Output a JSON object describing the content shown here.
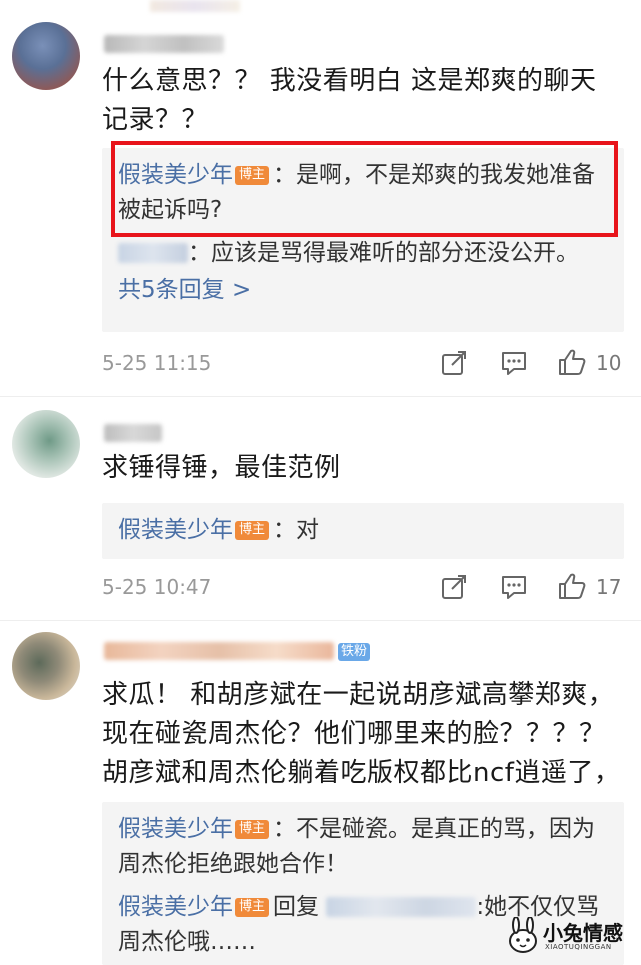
{
  "comments": [
    {
      "text": "什么意思？？ 我没看明白  这是郑爽的聊天记录？？",
      "replies": [
        {
          "name": "假装美少年",
          "badge": "博主",
          "text": "：是啊，不是郑爽的我发她准备被起诉吗?"
        },
        {
          "name": "",
          "text": "：应该是骂得最难听的部分还没公开。"
        }
      ],
      "more_replies": "共5条回复 >",
      "timestamp": "5-25 11:15",
      "like_count": "10"
    },
    {
      "text": "求锤得锤，最佳范例",
      "replies": [
        {
          "name": "假装美少年",
          "badge": "博主",
          "text": "：对"
        }
      ],
      "timestamp": "5-25 10:47",
      "like_count": "17"
    },
    {
      "fan_tag": "铁粉",
      "text": "求瓜！  和胡彦斌在一起说胡彦斌高攀郑爽，现在碰瓷周杰伦？他们哪里来的脸？？？？胡彦斌和周杰伦躺着吃版权都比ncf逍遥了，",
      "replies": [
        {
          "name": "假装美少年",
          "badge": "博主",
          "text": "：不是碰瓷。是真正的骂，因为周杰伦拒绝跟她合作！"
        },
        {
          "name": "假装美少年",
          "badge": "博主",
          "reply_word": "回复",
          "text": ":她不仅仅骂周杰伦哦……"
        }
      ]
    }
  ],
  "watermark": {
    "title": "小兔情感",
    "subtitle": "XIAOTUQINGGAN"
  },
  "colors": {
    "accent_link": "#4a6fa5",
    "badge": "#f08a3a",
    "highlight": "#e8141b",
    "reply_bg": "#f4f4f4"
  }
}
